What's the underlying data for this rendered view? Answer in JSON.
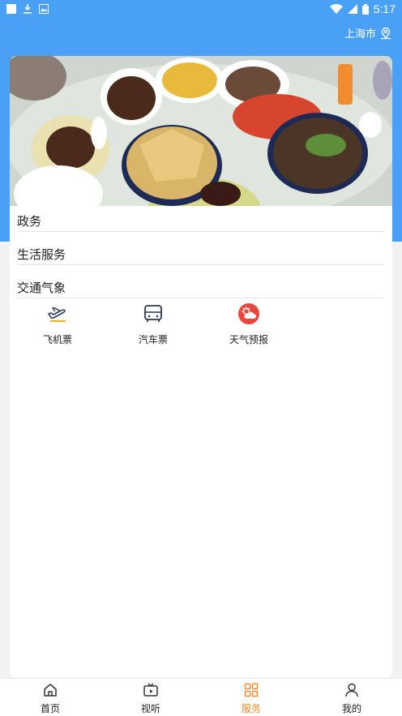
{
  "status_bar": {
    "time": "5:17"
  },
  "header": {
    "location": "上海市"
  },
  "sections": [
    {
      "label": "政务"
    },
    {
      "label": "生活服务"
    },
    {
      "label": "交通气象"
    }
  ],
  "services": [
    {
      "label": "飞机票",
      "icon": "airplane-icon"
    },
    {
      "label": "汽车票",
      "icon": "bus-icon"
    },
    {
      "label": "天气预报",
      "icon": "weather-icon"
    }
  ],
  "tabs": [
    {
      "label": "首页",
      "icon": "home-icon"
    },
    {
      "label": "视听",
      "icon": "tv-icon"
    },
    {
      "label": "服务",
      "icon": "grid-icon",
      "active": true
    },
    {
      "label": "我的",
      "icon": "user-icon"
    }
  ],
  "colors": {
    "primary": "#4aa0f4",
    "active_tab": "#f28a2e",
    "weather": "#e8453c",
    "airplane_accent": "#f2b705",
    "icon": "#2b3a55"
  }
}
